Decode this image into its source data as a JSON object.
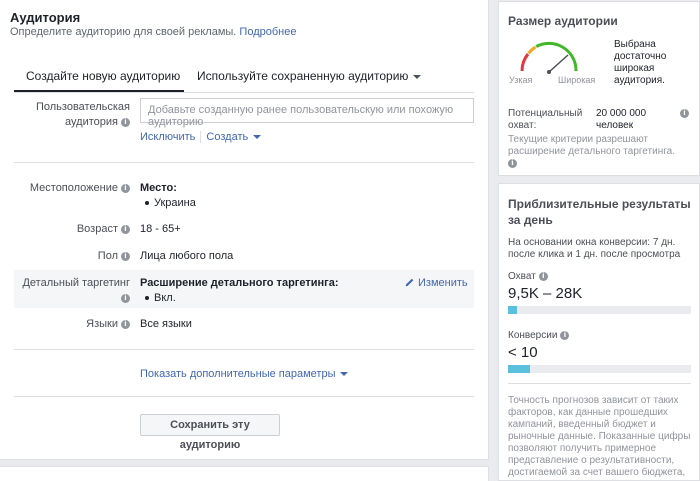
{
  "header": {
    "title": "Аудитория",
    "subtitle": "Определите аудиторию для своей рекламы.",
    "learn_more": "Подробнее"
  },
  "tabs": {
    "new": "Создайте новую аудиторию",
    "saved": "Используйте сохраненную аудиторию"
  },
  "custom_audience": {
    "label": "Пользовательская аудитория",
    "placeholder": "Добавьте созданную ранее пользовательскую или похожую аудиторию",
    "exclude": "Исключить",
    "create": "Создать"
  },
  "location": {
    "label": "Местоположение",
    "heading": "Место:",
    "value": "Украина"
  },
  "age": {
    "label": "Возраст",
    "value": "18 - 65+"
  },
  "gender": {
    "label": "Пол",
    "value": "Лица любого пола"
  },
  "detailed": {
    "label": "Детальный таргетинг",
    "heading": "Расширение детального таргетинга:",
    "value": "Вкл.",
    "edit": "Изменить"
  },
  "languages": {
    "label": "Языки",
    "value": "Все языки"
  },
  "more_options": "Показать дополнительные параметры",
  "save_button": "Сохранить эту аудиторию",
  "audience_size": {
    "title": "Размер аудитории",
    "description": "Выбрана достаточно широкая аудитория.",
    "narrow": "Узкая",
    "wide": "Широкая",
    "potential_label": "Потенциальный охват:",
    "potential_value": "20 000 000 человек",
    "criteria_note": "Текущие критерии разрешают расширение детального таргетинга."
  },
  "estimated": {
    "title": "Приблизительные результаты за день",
    "basis": "На основании окна конверсии: 7 дн. после клика и 1 дн. после просмотра",
    "reach_label": "Охват",
    "reach_value": "9,5K – 28K",
    "reach_fill": 0.05,
    "conversions_label": "Конверсии",
    "conversions_value": "< 10",
    "conversions_fill": 0.12,
    "note": "Точность прогнозов зависит от таких факторов, как данные прошедших кампаний, введенный бюджет и рыночные данные. Показанные цифры позволяют получить примерное представление о результативности, достигаемой за счет вашего бюджета,"
  },
  "colors": {
    "link": "#4267b2",
    "bar_fill": "#5bc0de",
    "gauge_red": "#e0393e",
    "gauge_green": "#42b72a"
  }
}
